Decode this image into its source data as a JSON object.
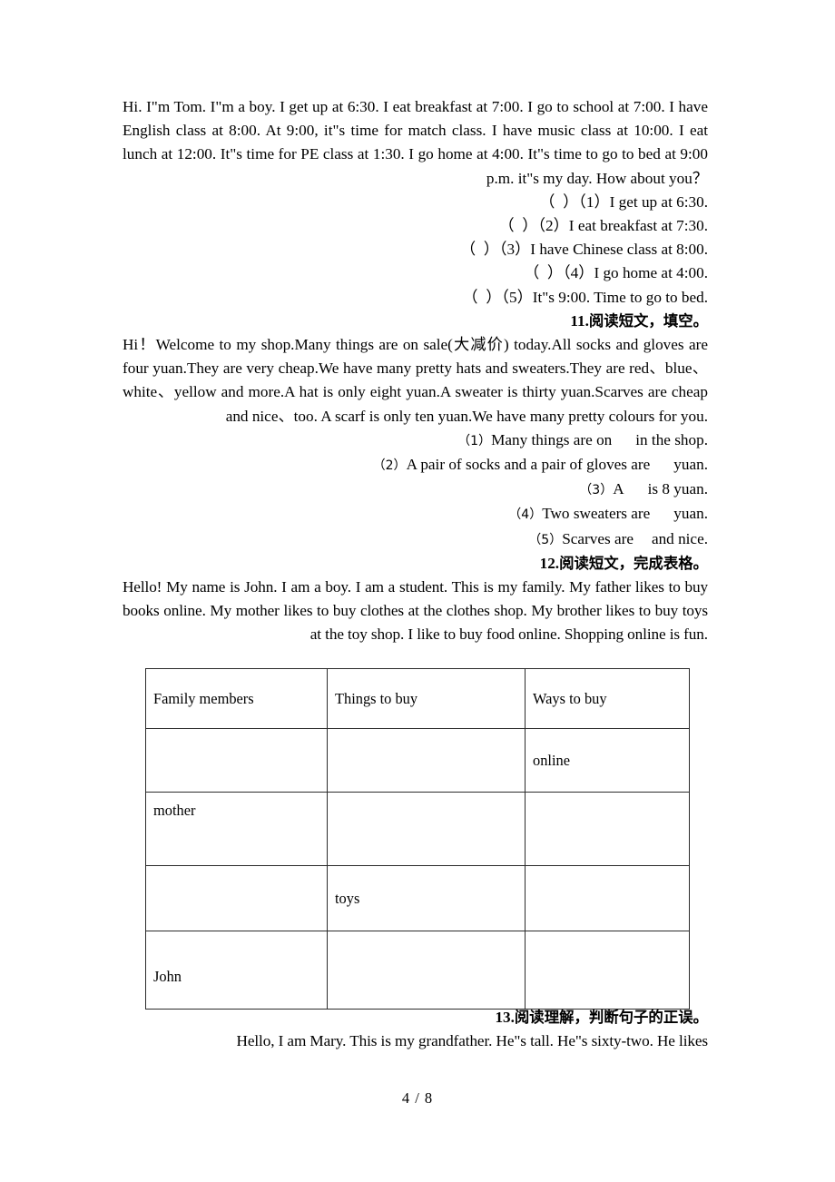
{
  "document": {
    "page_footer": "4 / 8"
  },
  "section10": {
    "passage": "Hi. I\"m Tom. I\"m a boy. I get up at 6:30. I eat breakfast at 7:00. I go to school at 7:00. I have English class at 8:00. At 9:00, it\"s time for match class. I have music class at 10:00. I eat lunch at 12:00. It\"s time for PE class at 1:30. I go home at 4:00. It\"s time to go to bed at 9:00 p.m. it\"s my day. How about you？",
    "questions": [
      "（  ）（1）I get up at 6:30.",
      "（  ）（2）I eat breakfast at 7:30.",
      "（  ）（3）I have Chinese class at 8:00.",
      "（  ）（4）I go home at 4:00.",
      "（  ）（5）It\"s 9:00. Time to go to bed."
    ]
  },
  "section11": {
    "heading_number": "11.",
    "heading_text": "阅读短文，填空。",
    "passage": "Hi！Welcome to my shop.Many things are on sale(大减价) today.All socks and gloves are four yuan.They are very cheap.We have many pretty hats and sweaters.They are red、blue、white、yellow and more.A hat is only eight yuan.A sweater is thirty yuan.Scarves are cheap and nice、too. A scarf is only ten yuan.We have many pretty colours for you.",
    "questions": [
      {
        "label": "（1）",
        "before": "Many things are on",
        "after": "in the shop."
      },
      {
        "label": "（2）",
        "before": "A pair of socks and a pair of gloves are",
        "after": "yuan."
      },
      {
        "label": "（3）",
        "before": "A",
        "after": "is 8 yuan."
      },
      {
        "label": "（4）",
        "before": "Two sweaters are",
        "after": "yuan."
      },
      {
        "label": "（5）",
        "before": "Scarves are",
        "after": "and nice."
      }
    ]
  },
  "section12": {
    "heading_number": "12.",
    "heading_text": "阅读短文，完成表格。",
    "passage": "Hello! My name is John. I am a boy. I am a student. This is my family. My father likes to buy books online. My mother likes to buy clothes at the clothes shop. My brother likes to buy toys at the toy shop. I like to buy food online. Shopping online is fun.",
    "table": {
      "headers": [
        "Family members",
        "Things to buy",
        "Ways to buy"
      ],
      "rows": [
        [
          "",
          "",
          "online"
        ],
        [
          "mother",
          "",
          ""
        ],
        [
          "",
          "toys",
          ""
        ],
        [
          "John",
          "",
          ""
        ]
      ]
    }
  },
  "section13": {
    "heading_number": "13.",
    "heading_text": "阅读理解，判断句子的正误。",
    "passage": "Hello, I am Mary. This is my grandfather. He\"s tall. He\"s  sixty-two. He likes"
  }
}
